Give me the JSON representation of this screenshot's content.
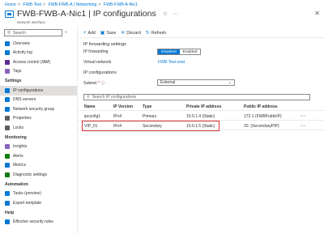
{
  "breadcrumb": [
    "Home",
    "FWB-Test",
    "FWB-FWB-A | Networking",
    "FWB-FWB-A-Nic1"
  ],
  "title": "FWB-FWB-A-Nic1 | IP configurations",
  "subtitle": "Network interface",
  "sidebar": {
    "search_placeholder": "Search",
    "top_items": [
      {
        "label": "Overview",
        "color": "#0078d4"
      },
      {
        "label": "Activity log",
        "color": "#0078d4"
      },
      {
        "label": "Access control (IAM)",
        "color": "#5c2d91"
      },
      {
        "label": "Tags",
        "color": "#8764b8"
      }
    ],
    "sections": [
      {
        "title": "Settings",
        "items": [
          {
            "label": "IP configurations",
            "color": "#0078d4",
            "active": true
          },
          {
            "label": "DNS servers",
            "color": "#0078d4"
          },
          {
            "label": "Network security group",
            "color": "#0078d4"
          },
          {
            "label": "Properties",
            "color": "#605e5c"
          },
          {
            "label": "Locks",
            "color": "#605e5c"
          }
        ]
      },
      {
        "title": "Monitoring",
        "items": [
          {
            "label": "Insights",
            "color": "#8764b8"
          },
          {
            "label": "Alerts",
            "color": "#107c10"
          },
          {
            "label": "Metrics",
            "color": "#0078d4"
          },
          {
            "label": "Diagnostic settings",
            "color": "#107c10"
          }
        ]
      },
      {
        "title": "Automation",
        "items": [
          {
            "label": "Tasks (preview)",
            "color": "#0078d4"
          },
          {
            "label": "Export template",
            "color": "#0078d4"
          }
        ]
      },
      {
        "title": "Help",
        "items": [
          {
            "label": "Effective security rules",
            "color": "#0078d4"
          }
        ]
      }
    ]
  },
  "toolbar": {
    "add": "Add",
    "save": "Save",
    "discard": "Discard",
    "refresh": "Refresh"
  },
  "ip_forwarding": {
    "section_title": "IP forwarding settings",
    "label": "IP forwarding",
    "disabled": "Disabled",
    "enabled": "Enabled",
    "vnet_label": "Virtual network",
    "vnet_value": "FWB-Test-vnet"
  },
  "ip_config": {
    "section_title": "IP configurations",
    "subnet_label": "Subnet",
    "subnet_required": "*",
    "subnet_value": "External",
    "search_placeholder": "Search IP configurations"
  },
  "table": {
    "columns": [
      "Name",
      "IP Version",
      "Type",
      "Private IP address",
      "Public IP address"
    ],
    "rows": [
      {
        "name": "ipconfig1",
        "version": "IPv4",
        "type": "Primary",
        "private": "10.0.1.4 (Static)",
        "public": "172.1          (FWBPublicIP)",
        "more": "···"
      },
      {
        "name": "VIP_01",
        "version": "IPv4",
        "type": "Secondary",
        "private": "10.0.1.5 (Static)",
        "public": "20.          (SecondaryPIP)",
        "more": "···"
      }
    ]
  }
}
